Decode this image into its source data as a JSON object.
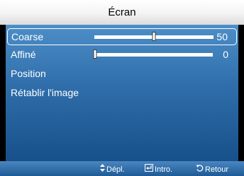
{
  "menu": {
    "title": "Écran",
    "items": [
      {
        "label": "Coarse",
        "value": "50",
        "level": 0.5,
        "selected": true
      },
      {
        "label": "Affiné",
        "value": "0",
        "level": 0.0,
        "selected": false
      },
      {
        "label": "Position"
      },
      {
        "label": "Rétablir l'image"
      }
    ]
  },
  "footer": {
    "move_label": "Dépl.",
    "move_icon": "updown-arrows-icon",
    "enter_label": "Intro.",
    "enter_icon": "enter-icon",
    "return_label": "Retour",
    "return_icon": "return-icon"
  },
  "colors": {
    "panel_top": "#4d8ec8",
    "panel_bottom": "#17508a",
    "title_bar": "#f3f3f3",
    "text": "#ffffff"
  }
}
